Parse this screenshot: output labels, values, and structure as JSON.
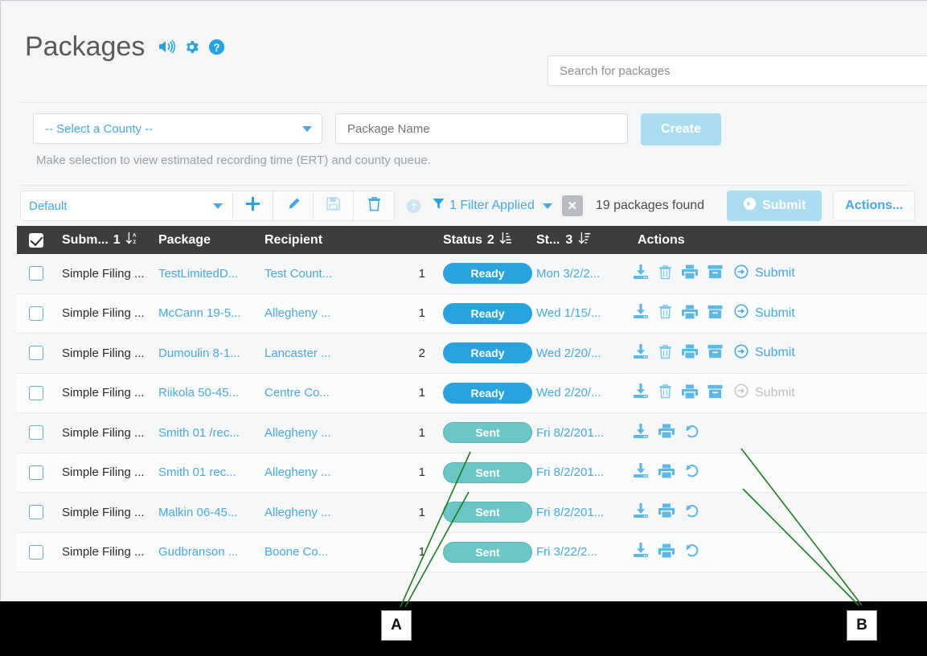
{
  "header": {
    "title": "Packages",
    "icons": [
      "speaker-icon",
      "gear-icon",
      "help-icon"
    ],
    "search_placeholder": "Search for packages"
  },
  "create_bar": {
    "county_select_value": "-- Select a County --",
    "package_name_placeholder": "Package Name",
    "create_label": "Create",
    "hint": "Make selection to view estimated recording time (ERT) and county queue."
  },
  "toolbar": {
    "view_value": "Default",
    "buttons": [
      "add-icon",
      "edit-icon",
      "save-icon",
      "delete-icon"
    ],
    "help_icon": "help-icon",
    "filter_label": "1 Filter Applied",
    "clear_filter_label": "✕",
    "found_label": "19 packages found",
    "submit_label": "Submit",
    "actions_label": "Actions..."
  },
  "table": {
    "columns": [
      {
        "label": "",
        "name": "select-all"
      },
      {
        "label": "Subm...",
        "sort_index": "1",
        "sort_icon": "sort-az-icon"
      },
      {
        "label": "Package"
      },
      {
        "label": "Recipient"
      },
      {
        "label": ""
      },
      {
        "label": "Status",
        "sort_index": "2",
        "sort_icon": "sort-desc-icon"
      },
      {
        "label": "St...",
        "sort_index": "3",
        "sort_icon": "sort-desc-icon"
      },
      {
        "label": "Actions"
      }
    ],
    "rows": [
      {
        "submitter": "Simple Filing ...",
        "package": "TestLimitedD...",
        "recipient": "Test Count...",
        "count": "1",
        "status": "Ready",
        "status_kind": "ready",
        "date": "Mon 3/2/2...",
        "icons": [
          "download-icon",
          "delete-icon",
          "print-icon",
          "archive-icon"
        ],
        "action": "Submit",
        "action_enabled": true
      },
      {
        "submitter": "Simple Filing ...",
        "package": "McCann 19-5...",
        "recipient": "Allegheny ...",
        "count": "1",
        "status": "Ready",
        "status_kind": "ready",
        "date": "Wed 1/15/...",
        "icons": [
          "download-icon",
          "delete-icon",
          "print-icon",
          "archive-icon"
        ],
        "action": "Submit",
        "action_enabled": true
      },
      {
        "submitter": "Simple Filing ...",
        "package": "Dumoulin 8-1...",
        "recipient": "Lancaster ...",
        "count": "2",
        "status": "Ready",
        "status_kind": "ready",
        "date": "Wed 2/20/...",
        "icons": [
          "download-icon",
          "delete-icon",
          "print-icon",
          "archive-icon"
        ],
        "action": "Submit",
        "action_enabled": true
      },
      {
        "submitter": "Simple Filing ...",
        "package": "Riikola 50-45...",
        "recipient": "Centre Co...",
        "count": "1",
        "status": "Ready",
        "status_kind": "ready",
        "date": "Wed 2/20/...",
        "icons": [
          "download-icon",
          "delete-icon",
          "print-icon",
          "archive-icon"
        ],
        "action": "Submit",
        "action_enabled": false
      },
      {
        "submitter": "Simple Filing ...",
        "package": "Smith 01 /rec...",
        "recipient": "Allegheny ...",
        "count": "1",
        "status": "Sent",
        "status_kind": "sent",
        "date": "Fri 8/2/201...",
        "icons": [
          "download-icon",
          "print-icon",
          "undo-icon"
        ],
        "action": "",
        "action_enabled": false
      },
      {
        "submitter": "Simple Filing ...",
        "package": "Smith 01 rec...",
        "recipient": "Allegheny ...",
        "count": "1",
        "status": "Sent",
        "status_kind": "sent",
        "date": "Fri 8/2/201...",
        "icons": [
          "download-icon",
          "print-icon",
          "undo-icon"
        ],
        "action": "",
        "action_enabled": false
      },
      {
        "submitter": "Simple Filing ...",
        "package": "Malkin 06-45...",
        "recipient": "Allegheny ...",
        "count": "1",
        "status": "Sent",
        "status_kind": "sent",
        "date": "Fri 8/2/201...",
        "icons": [
          "download-icon",
          "print-icon",
          "undo-icon"
        ],
        "action": "",
        "action_enabled": false
      },
      {
        "submitter": "Simple Filing ...",
        "package": "Gudbranson ...",
        "recipient": "Boone Co...",
        "count": "1",
        "status": "Sent",
        "status_kind": "sent",
        "date": "Fri 3/22/2...",
        "icons": [
          "download-icon",
          "print-icon",
          "undo-icon"
        ],
        "action": "",
        "action_enabled": false
      }
    ]
  },
  "annotations": {
    "marker_a": "A",
    "marker_b": "B",
    "line_color": "#1f7a21"
  },
  "colors": {
    "accent": "#29a3dd",
    "link": "#4aa8dd",
    "ready_badge": "#29a3dd",
    "sent_badge": "#6dc6c6",
    "header_bg": "#3d3d3d",
    "page_bg": "#f5f6f8"
  }
}
